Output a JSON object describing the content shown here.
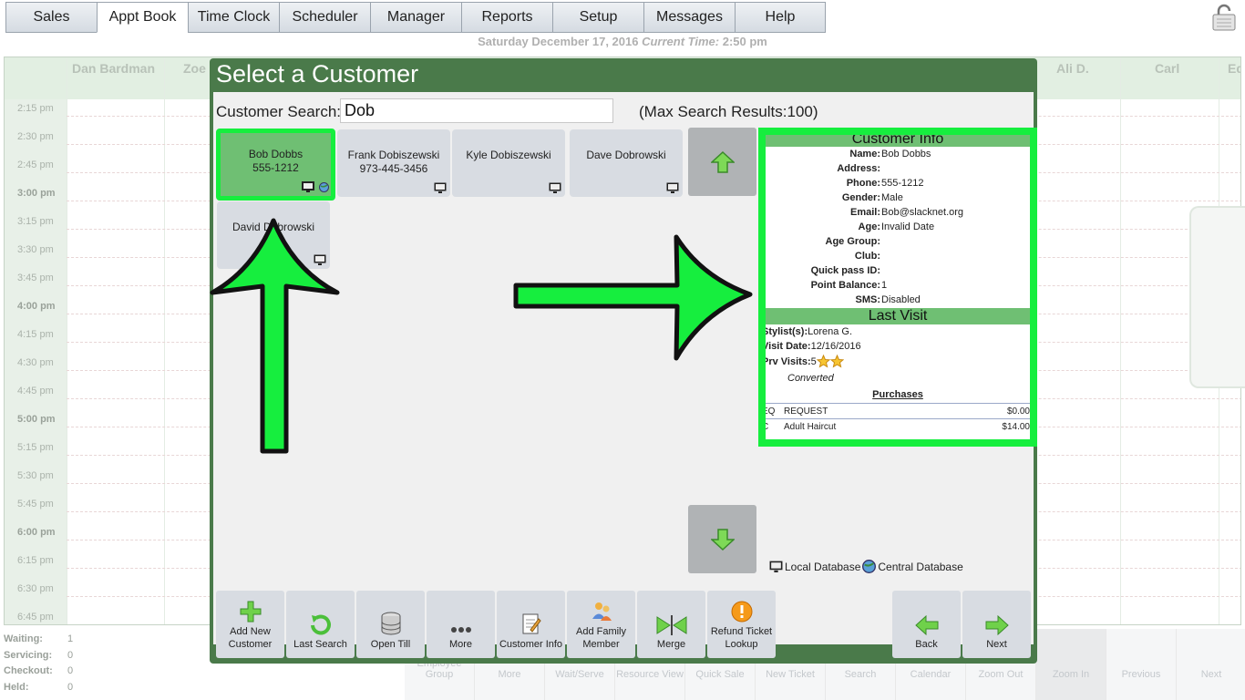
{
  "nav": {
    "tabs": [
      "Sales",
      "Appt Book",
      "Time Clock",
      "Scheduler",
      "Manager",
      "Reports",
      "Setup",
      "Messages",
      "Help"
    ],
    "active": "Appt Book"
  },
  "datebar": {
    "date": "Saturday December 17, 2016",
    "current_time_label": "Current Time:",
    "current_time": "2:50 pm"
  },
  "schedule": {
    "columns": [
      "Dan Bardman",
      "Zoe",
      "Ali D.",
      "Carl",
      "Ed"
    ],
    "times": [
      "2:15 pm",
      "2:30 pm",
      "2:45 pm",
      "3:00 pm",
      "3:15 pm",
      "3:30 pm",
      "3:45 pm",
      "4:00 pm",
      "4:15 pm",
      "4:30 pm",
      "4:45 pm",
      "5:00 pm",
      "5:15 pm",
      "5:30 pm",
      "5:45 pm",
      "6:00 pm",
      "6:15 pm",
      "6:30 pm",
      "6:45 pm"
    ]
  },
  "stats": [
    {
      "label": "Waiting:",
      "value": "1"
    },
    {
      "label": "Servicing:",
      "value": "0"
    },
    {
      "label": "Checkout:",
      "value": "0"
    },
    {
      "label": "Held:",
      "value": "0"
    }
  ],
  "bg_toolbar": [
    "Employee Group",
    "More",
    "Wait/Serve",
    "Resource View",
    "Quick Sale",
    "New Ticket",
    "Search",
    "Calendar",
    "Zoom Out",
    "Zoom In",
    "Previous",
    "Next"
  ],
  "modal": {
    "title": "Select a Customer",
    "search_label": "Customer Search:",
    "search_value": "Dob",
    "max_results": "(Max Search Results:100)",
    "customers": [
      {
        "name": "Bob Dobbs",
        "phone": "555-1212",
        "selected": true
      },
      {
        "name": "Frank Dobiszewski",
        "phone": "973-445-3456",
        "selected": false
      },
      {
        "name": "Kyle Dobiszewski",
        "phone": "",
        "selected": false
      },
      {
        "name": "Dave Dobrowski",
        "phone": "",
        "selected": false
      },
      {
        "name": "David Dobrowski",
        "phone": "",
        "selected": false
      }
    ],
    "legend": {
      "local": "Local Database",
      "central": "Central Database"
    }
  },
  "customer_info": {
    "header": "Customer Info",
    "fields": [
      {
        "label": "Name:",
        "value": "Bob Dobbs"
      },
      {
        "label": "Address:",
        "value": ""
      },
      {
        "label": "Phone:",
        "value": "555-1212"
      },
      {
        "label": "Gender:",
        "value": "Male"
      },
      {
        "label": "Email:",
        "value": "Bob@slacknet.org"
      },
      {
        "label": "Age:",
        "value": "Invalid Date"
      },
      {
        "label": "Age Group:",
        "value": ""
      },
      {
        "label": "Club:",
        "value": ""
      },
      {
        "label": "Quick pass ID:",
        "value": ""
      },
      {
        "label": "Point Balance:",
        "value": "1"
      },
      {
        "label": "SMS:",
        "value": "Disabled"
      }
    ],
    "last_visit": {
      "header": "Last Visit",
      "stylist_label": "Stylist(s):",
      "stylist": "Lorena G.",
      "date_label": "Visit Date:",
      "date": "12/16/2016",
      "prv_label": "Prv Visits:",
      "prv": "5",
      "converted": "Converted",
      "purchases_title": "Purchases",
      "purchases": [
        {
          "code": "EQ",
          "desc": "REQUEST",
          "amount": "$0.00"
        },
        {
          "code": "C",
          "desc": "Adult Haircut",
          "amount": "$14.00"
        }
      ]
    }
  },
  "toolbar": {
    "add_new_customer": "Add New Customer",
    "last_search": "Last Search",
    "open_till": "Open Till",
    "more": "More",
    "customer_info": "Customer Info",
    "add_family_member": "Add Family Member",
    "merge": "Merge",
    "refund_ticket_lookup": "Refund Ticket Lookup",
    "back": "Back",
    "next": "Next"
  },
  "colors": {
    "modal_green": "#4a7a4a",
    "highlight_green": "#16ee3e",
    "selected_card": "#6fbf73"
  }
}
